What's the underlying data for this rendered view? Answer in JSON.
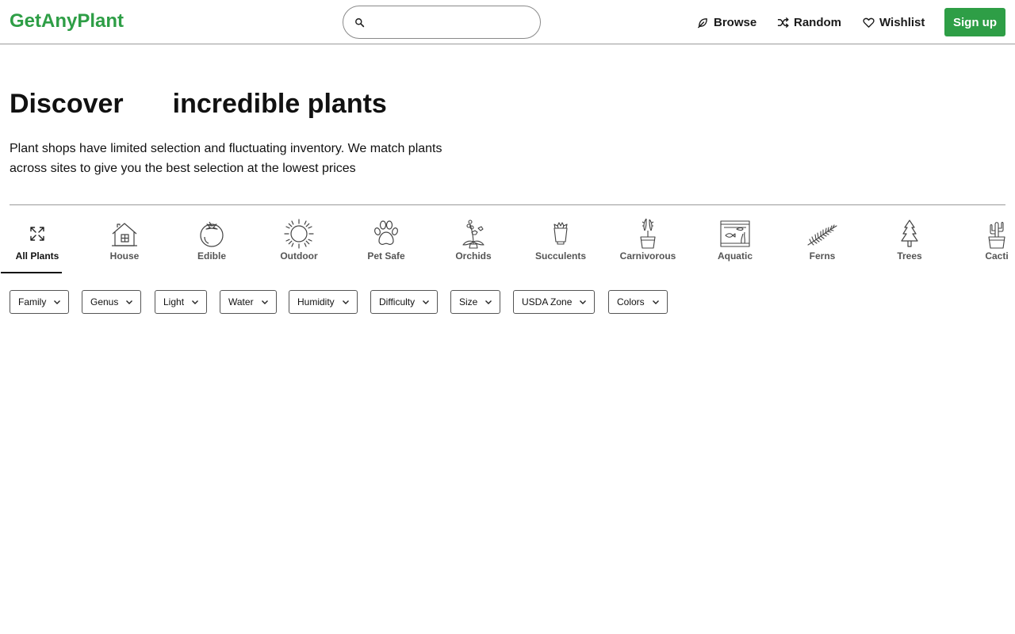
{
  "header": {
    "logo": "GetAnyPlant",
    "search": {
      "placeholder": "",
      "value": ""
    },
    "nav": [
      {
        "label": "Browse",
        "icon": "leaf-icon"
      },
      {
        "label": "Random",
        "icon": "shuffle-icon"
      },
      {
        "label": "Wishlist",
        "icon": "heart-icon"
      }
    ],
    "signup_label": "Sign up",
    "brand_color": "#2e9e46"
  },
  "hero": {
    "title_part1": "Discover",
    "title_part2": "incredible plants",
    "subtitle": "Plant shops have limited selection and fluctuating inventory. We match plants across sites to give you the best selection at the lowest prices"
  },
  "categories": [
    {
      "label": "All Plants",
      "icon": "expand-arrows-icon",
      "active": true
    },
    {
      "label": "House",
      "icon": "house-icon"
    },
    {
      "label": "Edible",
      "icon": "tomato-icon"
    },
    {
      "label": "Outdoor",
      "icon": "sun-icon"
    },
    {
      "label": "Pet Safe",
      "icon": "paw-icon"
    },
    {
      "label": "Orchids",
      "icon": "orchid-icon"
    },
    {
      "label": "Succulents",
      "icon": "succulent-icon"
    },
    {
      "label": "Carnivorous",
      "icon": "carnivorous-plant-icon"
    },
    {
      "label": "Aquatic",
      "icon": "aquarium-icon"
    },
    {
      "label": "Ferns",
      "icon": "fern-icon"
    },
    {
      "label": "Trees",
      "icon": "tree-icon"
    },
    {
      "label": "Cacti",
      "icon": "cactus-icon"
    }
  ],
  "filters": [
    {
      "label": "Family"
    },
    {
      "label": "Genus"
    },
    {
      "label": "Light"
    },
    {
      "label": "Water"
    },
    {
      "label": "Humidity"
    },
    {
      "label": "Difficulty"
    },
    {
      "label": "Size"
    },
    {
      "label": "USDA Zone"
    },
    {
      "label": "Colors"
    }
  ]
}
